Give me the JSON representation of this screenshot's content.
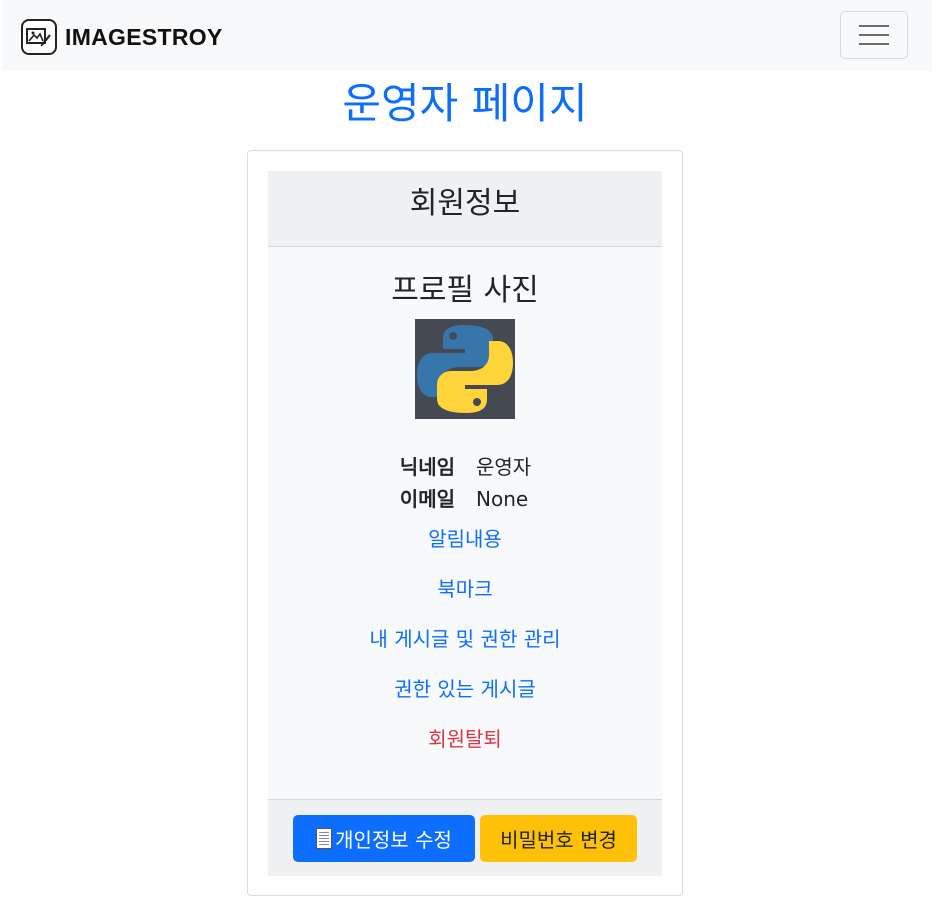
{
  "navbar": {
    "brand": "IMAGESTROY",
    "logo_icon": "image-edit-icon",
    "toggler_icon": "hamburger-menu-icon"
  },
  "page": {
    "title": "운영자 페이지"
  },
  "card": {
    "header": "회원정보",
    "profile_title": "프로필 사진",
    "avatar_icon": "python-logo",
    "nickname_label": "닉네임",
    "nickname_value": "운영자",
    "email_label": "이메일",
    "email_value": "None",
    "links": [
      {
        "label": "알림내용"
      },
      {
        "label": "북마크"
      },
      {
        "label": "내 게시글 및 권한 관리"
      },
      {
        "label": "권한 있는 게시글"
      },
      {
        "label": "회원탈퇴",
        "color": "#dc3545"
      }
    ],
    "footer": {
      "edit_profile_label": "개인정보 수정",
      "edit_profile_icon": "document-icon",
      "change_password_label": "비밀번호 변경"
    }
  },
  "colors": {
    "primary": "#0d6efd",
    "warning": "#ffc107",
    "danger": "#dc3545"
  }
}
